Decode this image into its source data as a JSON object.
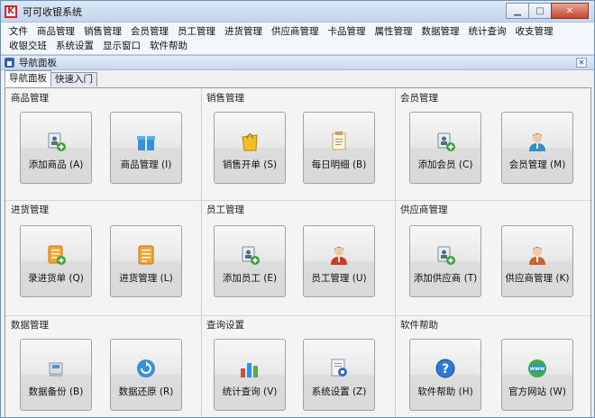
{
  "window": {
    "title": "可可收银系统",
    "logo_letter": "K"
  },
  "menu": {
    "row1": [
      "文件",
      "商品管理",
      "销售管理",
      "会员管理",
      "员工管理",
      "进货管理",
      "供应商管理",
      "卡品管理",
      "属性管理",
      "数据管理",
      "统计查询",
      "收支管理"
    ],
    "row2": [
      "收银交班",
      "系统设置",
      "显示窗口",
      "软件帮助"
    ]
  },
  "panel": {
    "title": "导航面板"
  },
  "tabs": [
    "导航面板",
    "快速入门"
  ],
  "groups": [
    {
      "title": "商品管理",
      "buttons": [
        {
          "label": "添加商品 (A)",
          "icon": "add-product-icon"
        },
        {
          "label": "商品管理 (I)",
          "icon": "gift-box-icon"
        }
      ]
    },
    {
      "title": "销售管理",
      "buttons": [
        {
          "label": "销售开单 (S)",
          "icon": "shopping-bag-icon"
        },
        {
          "label": "每日明细 (B)",
          "icon": "daily-report-icon"
        }
      ]
    },
    {
      "title": "会员管理",
      "buttons": [
        {
          "label": "添加会员 (C)",
          "icon": "add-member-icon"
        },
        {
          "label": "会员管理 (M)",
          "icon": "member-icon"
        }
      ]
    },
    {
      "title": "进货管理",
      "buttons": [
        {
          "label": "录进货单 (Q)",
          "icon": "add-purchase-icon"
        },
        {
          "label": "进货管理 (L)",
          "icon": "purchase-list-icon"
        }
      ]
    },
    {
      "title": "员工管理",
      "buttons": [
        {
          "label": "添加员工 (E)",
          "icon": "add-employee-icon"
        },
        {
          "label": "员工管理 (U)",
          "icon": "employee-icon"
        }
      ]
    },
    {
      "title": "供应商管理",
      "buttons": [
        {
          "label": "添加供应商 (T)",
          "icon": "add-supplier-icon"
        },
        {
          "label": "供应商管理 (K)",
          "icon": "supplier-icon"
        }
      ]
    },
    {
      "title": "数据管理",
      "buttons": [
        {
          "label": "数据备份 (B)",
          "icon": "backup-icon"
        },
        {
          "label": "数据还原 (R)",
          "icon": "restore-icon"
        }
      ]
    },
    {
      "title": "查询设置",
      "buttons": [
        {
          "label": "统计查询 (V)",
          "icon": "bar-chart-icon"
        },
        {
          "label": "系统设置 (Z)",
          "icon": "settings-icon"
        }
      ]
    },
    {
      "title": "软件帮助",
      "buttons": [
        {
          "label": "软件帮助 (H)",
          "icon": "help-icon"
        },
        {
          "label": "官方网站 (W)",
          "icon": "website-icon"
        }
      ]
    }
  ]
}
